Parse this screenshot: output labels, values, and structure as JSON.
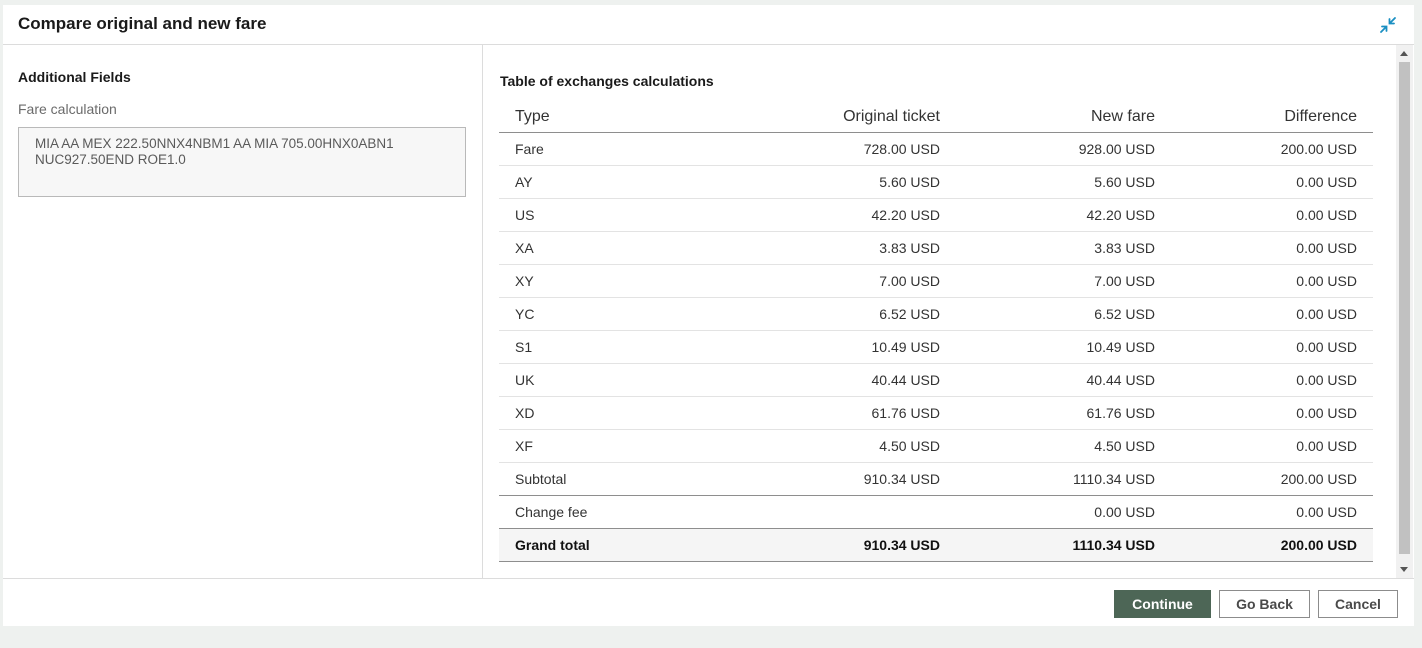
{
  "dialog": {
    "title": "Compare original and new fare",
    "collapse_icon": "collapse-arrows-icon",
    "accent_color": "#1a8fc2"
  },
  "left": {
    "section_title": "Additional Fields",
    "fare_calculation_label": "Fare calculation",
    "fare_calculation_value": "MIA AA MEX 222.50NNX4NBM1 AA MIA 705.00HNX0ABN1\nNUC927.50END ROE1.0"
  },
  "right": {
    "table_title": "Table of exchanges calculations",
    "columns": [
      "Type",
      "Original ticket",
      "New fare",
      "Difference"
    ],
    "rows": [
      {
        "type": "Fare",
        "original": "728.00 USD",
        "new": "928.00 USD",
        "diff": "200.00 USD"
      },
      {
        "type": "AY",
        "original": "5.60 USD",
        "new": "5.60 USD",
        "diff": "0.00 USD"
      },
      {
        "type": "US",
        "original": "42.20 USD",
        "new": "42.20 USD",
        "diff": "0.00 USD"
      },
      {
        "type": "XA",
        "original": "3.83 USD",
        "new": "3.83 USD",
        "diff": "0.00 USD"
      },
      {
        "type": "XY",
        "original": "7.00 USD",
        "new": "7.00 USD",
        "diff": "0.00 USD"
      },
      {
        "type": "YC",
        "original": "6.52 USD",
        "new": "6.52 USD",
        "diff": "0.00 USD"
      },
      {
        "type": "S1",
        "original": "10.49 USD",
        "new": "10.49 USD",
        "diff": "0.00 USD"
      },
      {
        "type": "UK",
        "original": "40.44 USD",
        "new": "40.44 USD",
        "diff": "0.00 USD"
      },
      {
        "type": "XD",
        "original": "61.76 USD",
        "new": "61.76 USD",
        "diff": "0.00 USD"
      },
      {
        "type": "XF",
        "original": "4.50 USD",
        "new": "4.50 USD",
        "diff": "0.00 USD"
      }
    ],
    "subtotal": {
      "type": "Subtotal",
      "original": "910.34 USD",
      "new": "1110.34 USD",
      "diff": "200.00 USD"
    },
    "change_fee": {
      "type": "Change fee",
      "original": "",
      "new": "0.00 USD",
      "diff": "0.00 USD"
    },
    "grand_total": {
      "type": "Grand total",
      "original": "910.34 USD",
      "new": "1110.34 USD",
      "diff": "200.00 USD"
    }
  },
  "footer": {
    "continue_label": "Continue",
    "goback_label": "Go Back",
    "cancel_label": "Cancel",
    "primary_color": "#4d6656"
  }
}
